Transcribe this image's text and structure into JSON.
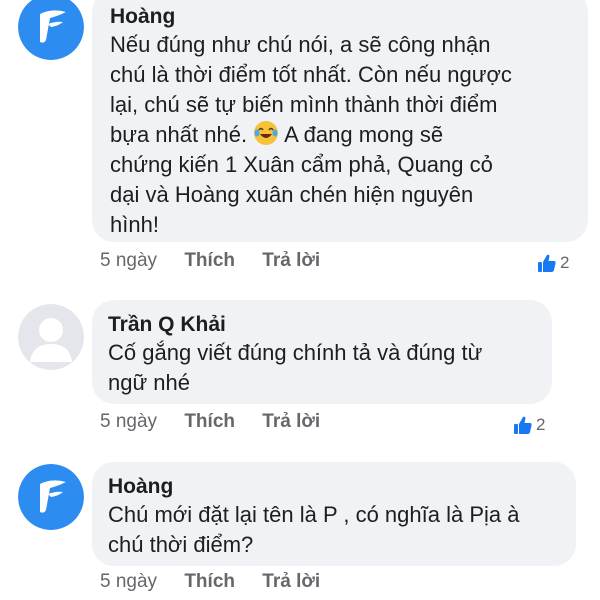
{
  "comments": [
    {
      "author": "Hoàng",
      "avatar_icon": "brand-logo-icon",
      "text_before_emoji": "Nếu đúng như chú nói, a sẽ công nhận\nchú là thời điểm tốt nhất. Còn nếu ngược\nlại, chú sẽ tự biến mình thành thời điểm\nbựa nhất nhé. ",
      "emoji": "laughing-tears-emoji",
      "text_after_emoji": " A đang mong sẽ\nchứng kiến 1 Xuân cẩm phả, Quang cỏ\ndại và Hoàng xuân chén hiện nguyên\nhình!",
      "time": "5 ngày",
      "like_label": "Thích",
      "reply_label": "Trả lời",
      "reaction_count": "2"
    },
    {
      "author": "Trần Q Khải",
      "avatar_icon": "default-user-avatar-icon",
      "text": "Cố gắng viết đúng chính tả và đúng từ\nngữ nhé",
      "time": "5 ngày",
      "like_label": "Thích",
      "reply_label": "Trả lời",
      "reaction_count": "2"
    },
    {
      "author": "Hoàng",
      "avatar_icon": "brand-logo-icon",
      "text": "Chú mới đặt lại tên là P , có nghĩa là Pịa à\nchú thời điểm?",
      "time": "5 ngày",
      "like_label": "Thích",
      "reply_label": "Trả lời"
    }
  ],
  "colors": {
    "bubble": "#f0f2f5",
    "meta_text": "#65676b",
    "like_blue": "#1877f2",
    "avatar_blue": "#2d8cf0"
  }
}
